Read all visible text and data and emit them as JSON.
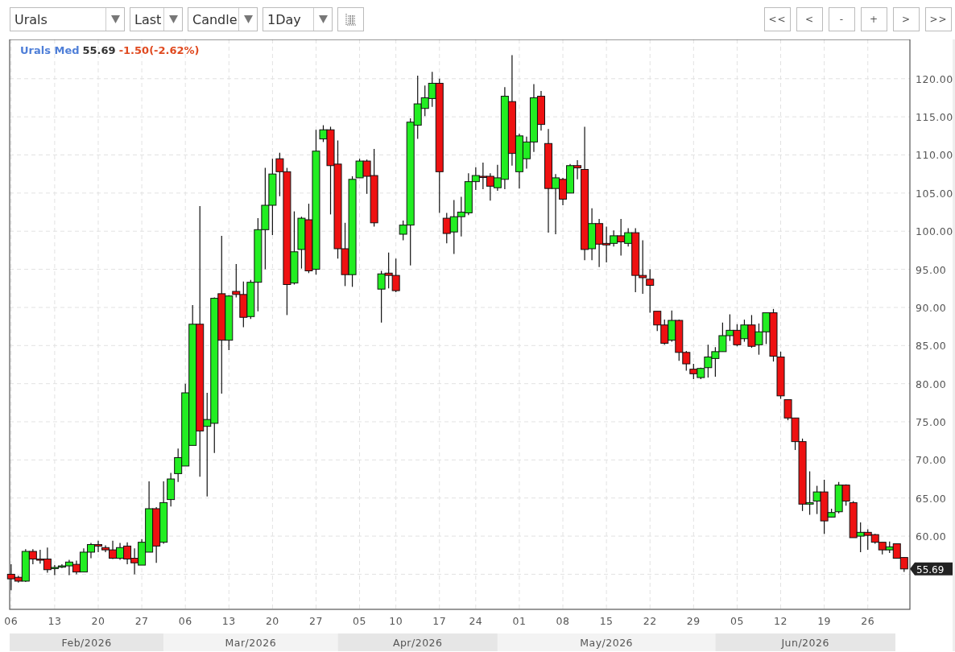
{
  "toolbar": {
    "dropdowns": [
      {
        "value": "Urals",
        "kind": "wide"
      },
      {
        "value": "Last",
        "kind": "narrow"
      },
      {
        "value": "Candle",
        "kind": "medium"
      },
      {
        "value": "1Day",
        "kind": "medium"
      }
    ],
    "nav_buttons": [
      "<<",
      "<",
      "-",
      "+",
      ">",
      ">>"
    ]
  },
  "chart": {
    "legend": {
      "symbol": "Urals Med",
      "price": "55.69",
      "change": "-1.50(-2.62%)"
    },
    "price_tag": "55.69",
    "months": [
      {
        "label": "Feb/2026",
        "shaded": true
      },
      {
        "label": "Mar/2026",
        "shaded": false
      },
      {
        "label": "Apr/2026",
        "shaded": true
      },
      {
        "label": "May/2026",
        "shaded": false
      },
      {
        "label": "Jun/2026",
        "shaded": true
      }
    ],
    "chart_data": {
      "type": "candlestick",
      "grid": true,
      "ylim": [
        50.4,
        125.15
      ],
      "yticks": [
        {
          "value": 60,
          "label": "60.00"
        },
        {
          "value": 65,
          "label": "65.00"
        },
        {
          "value": 70,
          "label": "70.00"
        },
        {
          "value": 75,
          "label": "75.00"
        },
        {
          "value": 80,
          "label": "80.00"
        },
        {
          "value": 85,
          "label": "85.00"
        },
        {
          "value": 90,
          "label": "90.00"
        },
        {
          "value": 95,
          "label": "95.00"
        },
        {
          "value": 100,
          "label": "100.00"
        },
        {
          "value": 105,
          "label": "105.00"
        },
        {
          "value": 110,
          "label": "110.00"
        },
        {
          "value": 115,
          "label": "115.00"
        },
        {
          "value": 120,
          "label": "120.00"
        }
      ],
      "categories": [
        "06",
        null,
        null,
        null,
        null,
        null,
        "13",
        null,
        null,
        null,
        null,
        null,
        "20",
        null,
        null,
        null,
        null,
        null,
        "27",
        null,
        null,
        null,
        null,
        null,
        "06",
        null,
        null,
        null,
        null,
        null,
        "13",
        null,
        null,
        null,
        null,
        null,
        "20",
        null,
        null,
        null,
        null,
        null,
        "27",
        null,
        null,
        null,
        null,
        null,
        "05",
        null,
        null,
        null,
        null,
        "10",
        null,
        null,
        null,
        null,
        null,
        "17",
        null,
        null,
        null,
        null,
        "24",
        null,
        null,
        null,
        null,
        null,
        "01",
        null,
        null,
        null,
        null,
        null,
        "08",
        null,
        null,
        null,
        null,
        null,
        "15",
        null,
        null,
        null,
        null,
        null,
        "22",
        null,
        null,
        null,
        null,
        null,
        "29",
        null,
        null,
        null,
        null,
        null,
        "05",
        null,
        null,
        null,
        null,
        null,
        "12",
        null,
        null,
        null,
        null,
        null,
        "19",
        null,
        null,
        null,
        null,
        null,
        "26",
        null,
        null,
        null,
        null,
        null
      ],
      "ohlc": [
        [
          55.0,
          56.3,
          52.9,
          54.4
        ],
        [
          54.6,
          54.8,
          53.9,
          54.1
        ],
        [
          54.1,
          58.3,
          54.0,
          58.0
        ],
        [
          58.0,
          58.3,
          56.3,
          57.0
        ],
        [
          57.0,
          58.2,
          56.4,
          56.9
        ],
        [
          57.0,
          58.5,
          55.2,
          55.6
        ],
        [
          55.8,
          56.2,
          54.9,
          55.9
        ],
        [
          56.0,
          56.3,
          55.8,
          56.1
        ],
        [
          56.1,
          56.9,
          54.9,
          56.6
        ],
        [
          56.3,
          56.8,
          55.0,
          55.3
        ],
        [
          55.3,
          58.4,
          55.3,
          57.9
        ],
        [
          57.9,
          59.1,
          57.1,
          58.9
        ],
        [
          58.9,
          59.4,
          57.9,
          58.7
        ],
        [
          58.5,
          58.8,
          57.9,
          58.2
        ],
        [
          58.2,
          59.4,
          57.0,
          57.1
        ],
        [
          57.1,
          59.1,
          56.9,
          58.5
        ],
        [
          58.7,
          59.2,
          56.3,
          57.0
        ],
        [
          57.1,
          58.4,
          55.0,
          56.5
        ],
        [
          56.2,
          59.6,
          56.2,
          59.2
        ],
        [
          57.9,
          67.2,
          57.9,
          63.6
        ],
        [
          63.6,
          63.8,
          56.5,
          58.7
        ],
        [
          59.2,
          67.2,
          59.0,
          64.4
        ],
        [
          64.8,
          68.3,
          63.9,
          67.5
        ],
        [
          68.2,
          71.5,
          67.1,
          70.3
        ],
        [
          69.2,
          80.0,
          69.2,
          78.8
        ],
        [
          71.9,
          90.3,
          71.9,
          87.8
        ],
        [
          87.8,
          103.3,
          67.8,
          73.8
        ],
        [
          74.4,
          78.8,
          65.2,
          75.3
        ],
        [
          74.8,
          91.3,
          70.9,
          91.2
        ],
        [
          91.8,
          99.4,
          78.7,
          85.7
        ],
        [
          85.7,
          91.6,
          84.4,
          91.5
        ],
        [
          92.1,
          95.7,
          91.3,
          91.7
        ],
        [
          91.7,
          93.4,
          87.4,
          88.7
        ],
        [
          88.8,
          93.6,
          88.5,
          93.3
        ],
        [
          93.3,
          101.7,
          89.5,
          100.2
        ],
        [
          100.2,
          108.3,
          95.0,
          103.4
        ],
        [
          103.4,
          109.5,
          99.5,
          107.5
        ],
        [
          109.5,
          110.3,
          104.6,
          107.8
        ],
        [
          107.8,
          108.3,
          89.0,
          93.0
        ],
        [
          93.2,
          102.6,
          93.0,
          97.3
        ],
        [
          97.6,
          101.9,
          95.1,
          101.7
        ],
        [
          101.5,
          103.6,
          94.5,
          94.8
        ],
        [
          95.0,
          113.3,
          94.3,
          110.5
        ],
        [
          112.1,
          113.9,
          111.7,
          113.3
        ],
        [
          113.3,
          113.7,
          102.2,
          108.6
        ],
        [
          108.8,
          111.9,
          96.4,
          97.7
        ],
        [
          97.7,
          101.1,
          92.8,
          94.3
        ],
        [
          94.3,
          107.2,
          92.7,
          106.8
        ],
        [
          107.0,
          109.5,
          107.0,
          109.2
        ],
        [
          109.2,
          109.4,
          104.9,
          107.2
        ],
        [
          107.3,
          110.8,
          100.6,
          101.1
        ],
        [
          92.4,
          94.8,
          88.0,
          94.4
        ],
        [
          94.5,
          97.2,
          92.5,
          94.2
        ],
        [
          94.2,
          96.4,
          92.0,
          92.2
        ],
        [
          99.6,
          101.4,
          98.8,
          100.8
        ],
        [
          100.8,
          114.8,
          95.5,
          114.3
        ],
        [
          113.9,
          120.4,
          112.1,
          116.7
        ],
        [
          116.1,
          119.1,
          115.1,
          117.5
        ],
        [
          117.4,
          120.9,
          116.3,
          119.4
        ],
        [
          119.4,
          120.0,
          102.4,
          107.8
        ],
        [
          101.7,
          102.4,
          98.4,
          99.7
        ],
        [
          99.9,
          104.1,
          97.0,
          101.9
        ],
        [
          101.9,
          104.5,
          99.3,
          102.5
        ],
        [
          102.4,
          107.6,
          102.1,
          106.5
        ],
        [
          106.5,
          108.4,
          105.4,
          107.3
        ],
        [
          107.2,
          109.0,
          105.5,
          107.1
        ],
        [
          107.2,
          107.6,
          104.0,
          105.9
        ],
        [
          105.7,
          108.7,
          105.3,
          107.0
        ],
        [
          106.8,
          118.9,
          105.5,
          117.7
        ],
        [
          117.0,
          123.1,
          108.6,
          110.2
        ],
        [
          107.8,
          112.8,
          105.6,
          112.5
        ],
        [
          109.5,
          112.4,
          108.2,
          111.7
        ],
        [
          111.7,
          119.3,
          110.4,
          117.5
        ],
        [
          117.7,
          118.4,
          113.2,
          114.0
        ],
        [
          111.5,
          113.4,
          99.8,
          105.6
        ],
        [
          105.6,
          107.5,
          99.6,
          107.0
        ],
        [
          106.8,
          107.0,
          103.4,
          104.2
        ],
        [
          105.0,
          108.8,
          105.0,
          108.6
        ],
        [
          108.6,
          109.3,
          106.8,
          108.3
        ],
        [
          108.1,
          113.7,
          96.2,
          97.6
        ],
        [
          97.7,
          103.0,
          96.2,
          101.0
        ],
        [
          101.0,
          101.6,
          95.3,
          98.3
        ],
        [
          98.4,
          100.6,
          95.9,
          98.2
        ],
        [
          98.4,
          100.1,
          98.0,
          99.4
        ],
        [
          99.4,
          101.6,
          96.8,
          98.6
        ],
        [
          98.4,
          100.4,
          98.0,
          99.8
        ],
        [
          99.8,
          100.4,
          92.0,
          94.2
        ],
        [
          94.2,
          98.8,
          91.8,
          93.9
        ],
        [
          93.7,
          95.0,
          89.3,
          92.9
        ],
        [
          89.5,
          89.5,
          86.9,
          87.7
        ],
        [
          87.7,
          88.4,
          85.1,
          85.3
        ],
        [
          85.7,
          89.6,
          85.5,
          88.3
        ],
        [
          88.3,
          88.4,
          83.0,
          84.1
        ],
        [
          84.1,
          84.3,
          81.7,
          82.6
        ],
        [
          81.9,
          82.6,
          80.6,
          81.3
        ],
        [
          80.8,
          82.1,
          80.6,
          82.0
        ],
        [
          82.1,
          85.1,
          80.8,
          83.5
        ],
        [
          83.3,
          84.8,
          80.9,
          84.2
        ],
        [
          84.2,
          88.0,
          84.2,
          86.3
        ],
        [
          86.3,
          89.1,
          85.6,
          87.0
        ],
        [
          87.0,
          87.8,
          84.9,
          85.1
        ],
        [
          85.9,
          88.4,
          85.5,
          87.7
        ],
        [
          87.7,
          89.0,
          84.7,
          84.9
        ],
        [
          85.1,
          87.9,
          83.8,
          86.8
        ],
        [
          86.8,
          89.3,
          85.2,
          89.3
        ],
        [
          89.3,
          89.8,
          82.9,
          83.6
        ],
        [
          83.5,
          84.2,
          78.0,
          78.4
        ],
        [
          77.9,
          77.9,
          75.2,
          75.5
        ],
        [
          75.5,
          75.5,
          71.3,
          72.4
        ],
        [
          72.4,
          72.8,
          63.3,
          64.2
        ],
        [
          64.2,
          68.5,
          62.8,
          64.4
        ],
        [
          64.6,
          66.6,
          62.9,
          65.8
        ],
        [
          65.8,
          67.4,
          60.3,
          62.0
        ],
        [
          62.5,
          63.6,
          62.5,
          63.1
        ],
        [
          63.2,
          67.1,
          63.0,
          66.7
        ],
        [
          66.7,
          66.8,
          64.0,
          64.6
        ],
        [
          64.4,
          64.6,
          59.8,
          59.8
        ],
        [
          60.0,
          61.8,
          57.9,
          60.5
        ],
        [
          60.5,
          60.9,
          58.2,
          60.1
        ],
        [
          60.2,
          60.3,
          59.0,
          59.2
        ],
        [
          59.2,
          59.2,
          57.6,
          58.2
        ],
        [
          58.2,
          59.3,
          57.8,
          58.6
        ],
        [
          59.0,
          59.0,
          57.1,
          57.1
        ],
        [
          57.2,
          57.2,
          55.3,
          55.7
        ]
      ]
    }
  }
}
